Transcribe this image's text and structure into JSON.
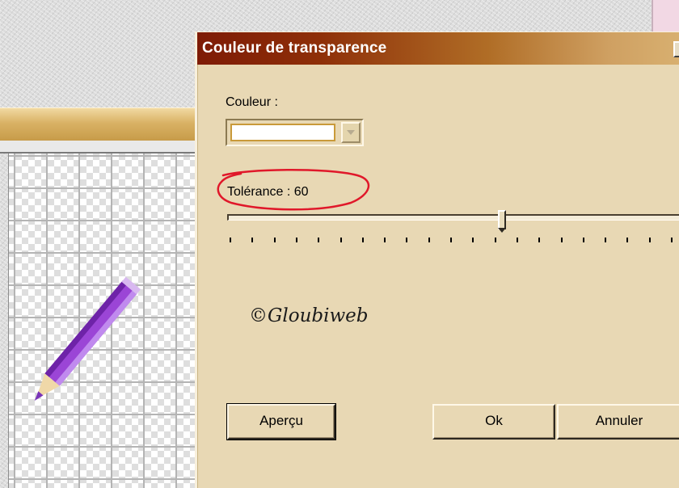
{
  "dialog": {
    "title": "Couleur de transparence",
    "color_label": "Couleur :",
    "selected_color": "#ffffff",
    "tolerance_label": "Tolérance : 60",
    "tolerance_value": 60,
    "watermark": "©Gloubiweb",
    "buttons": {
      "preview": "Aperçu",
      "ok": "Ok",
      "cancel": "Annuler"
    }
  },
  "colors": {
    "dialog_bg": "#e8d8b4",
    "titlebar_start": "#7e1b06",
    "titlebar_end": "#d8b070",
    "annotation": "#e0182a",
    "pencil": "#9b45d6"
  },
  "icons": {
    "canvas_object": "purple-pencil-icon"
  }
}
